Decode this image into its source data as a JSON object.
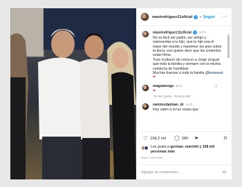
{
  "post": {
    "username": "maxirodriguez11oficial",
    "follow_label": "Seguir",
    "more_label": "···",
    "caption": {
      "username": "maxirodriguez11oficial",
      "time": "14 h",
      "text": "No es fácil ser padre, ser amigo y representar a tu hijo, que tu hijo sea el mejor del mundo y mantener los pies sobre la tierra, eso quiere decir que los cimientos están firme.\nTuve el placer de conocer a Jorge al igual que toda la familia y siempre con la misma conducta de humildad.\nMuchas fuerzas a toda la familia",
      "mention": "@leomessi",
      "emoji": "❤"
    },
    "comments": [
      {
        "username": "maguiacega",
        "time": "14 h",
        "text": "❤",
        "likes_label": "31 Me gusta",
        "reply_label": "Responder"
      },
      {
        "username": "ramirezdamian_dr",
        "time": "14 h",
        "text": "Hoy salen a la luz cosas que"
      }
    ],
    "actions": {
      "likes_count": "158,2 mil",
      "comments_count": "280"
    },
    "likes_text_prefix": "Les gusta a ",
    "likes_text_user": "german_mariotti",
    "likes_text_suffix": " y 158 mil personas más",
    "timestamp": "Hace 14 horas",
    "comment_placeholder": "Agrega un comentario...",
    "colors": {
      "accent": "#0095f6",
      "verified": "#3897f0",
      "like_heart": "#ed4956"
    }
  }
}
